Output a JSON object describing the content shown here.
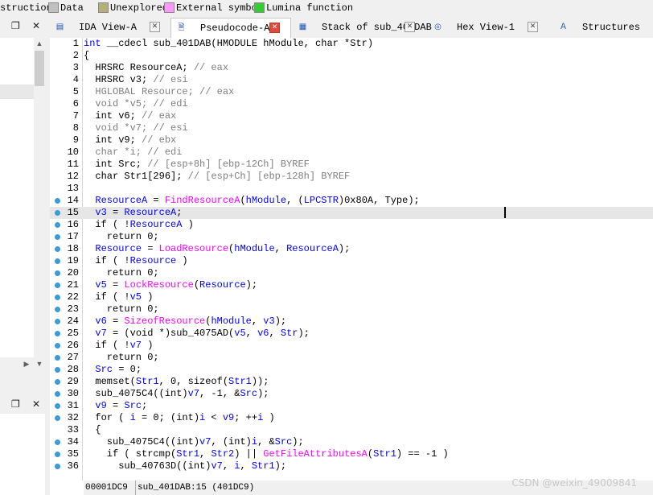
{
  "legend": {
    "items": [
      {
        "label": "struction",
        "color": null
      },
      {
        "label": "Data",
        "color": "#c0c0c0"
      },
      {
        "label": "Unexplored",
        "color": "#b5b07a"
      },
      {
        "label": "External symbol",
        "color": "#ff99ff"
      },
      {
        "label": "Lumina function",
        "color": "#33cc33"
      }
    ]
  },
  "left_pane": {
    "pin_icon": "pin-icon",
    "close_label": "✕"
  },
  "tabs": [
    {
      "label": "IDA View-A",
      "icon": "ida-view-icon",
      "active": false
    },
    {
      "label": "Pseudocode-A",
      "icon": "pseudocode-icon",
      "active": true
    },
    {
      "label": "Stack of sub_401DAB",
      "icon": "stack-icon",
      "active": false
    },
    {
      "label": "Hex View-1",
      "icon": "hex-icon",
      "active": false
    },
    {
      "label": "Structures",
      "icon": "structures-icon",
      "active": false
    }
  ],
  "code": {
    "current_line": 15,
    "lines": [
      {
        "n": "1",
        "bp": false,
        "seg": [
          [
            "t",
            "int"
          ],
          [
            "p",
            " __cdecl sub_401DAB(HMODULE hModule, char *Str)"
          ]
        ]
      },
      {
        "n": "2",
        "bp": false,
        "seg": [
          [
            "p",
            "{"
          ]
        ]
      },
      {
        "n": "3",
        "bp": false,
        "seg": [
          [
            "p",
            "  HRSRC ResourceA; "
          ],
          [
            "c",
            "// eax"
          ]
        ]
      },
      {
        "n": "4",
        "bp": false,
        "seg": [
          [
            "p",
            "  HRSRC v3; "
          ],
          [
            "c",
            "// esi"
          ]
        ]
      },
      {
        "n": "5",
        "bp": false,
        "seg": [
          [
            "c",
            "  HGLOBAL Resource; // eax"
          ]
        ]
      },
      {
        "n": "6",
        "bp": false,
        "seg": [
          [
            "c",
            "  void *v5; // edi"
          ]
        ]
      },
      {
        "n": "7",
        "bp": false,
        "seg": [
          [
            "p",
            "  int v6; "
          ],
          [
            "c",
            "// eax"
          ]
        ]
      },
      {
        "n": "8",
        "bp": false,
        "seg": [
          [
            "c",
            "  void *v7; // esi"
          ]
        ]
      },
      {
        "n": "9",
        "bp": false,
        "seg": [
          [
            "p",
            "  int v9; "
          ],
          [
            "c",
            "// ebx"
          ]
        ]
      },
      {
        "n": "10",
        "bp": false,
        "seg": [
          [
            "c",
            "  char *i; // edi"
          ]
        ]
      },
      {
        "n": "11",
        "bp": false,
        "seg": [
          [
            "p",
            "  int Src; "
          ],
          [
            "c",
            "// [esp+8h] [ebp-12Ch] BYREF"
          ]
        ]
      },
      {
        "n": "12",
        "bp": false,
        "seg": [
          [
            "p",
            "  char Str1[296]; "
          ],
          [
            "c",
            "// [esp+Ch] [ebp-128h] BYREF"
          ]
        ]
      },
      {
        "n": "13",
        "bp": false,
        "seg": [
          [
            "p",
            ""
          ]
        ]
      },
      {
        "n": "14",
        "bp": true,
        "seg": [
          [
            "v",
            "  ResourceA"
          ],
          [
            "p",
            " = "
          ],
          [
            "f",
            "FindResourceA"
          ],
          [
            "p",
            "("
          ],
          [
            "v",
            "hModule"
          ],
          [
            "p",
            ", ("
          ],
          [
            "v",
            "LPCSTR"
          ],
          [
            "p",
            ")0x80A, Type);"
          ]
        ]
      },
      {
        "n": "15",
        "bp": true,
        "seg": [
          [
            "v",
            "  v3"
          ],
          [
            "p",
            " = "
          ],
          [
            "v",
            "ResourceA"
          ],
          [
            "p",
            ";"
          ]
        ]
      },
      {
        "n": "16",
        "bp": true,
        "seg": [
          [
            "p",
            "  if ( !"
          ],
          [
            "v",
            "ResourceA"
          ],
          [
            "p",
            " )"
          ]
        ]
      },
      {
        "n": "17",
        "bp": true,
        "seg": [
          [
            "p",
            "    return 0;"
          ]
        ]
      },
      {
        "n": "18",
        "bp": true,
        "seg": [
          [
            "v",
            "  Resource"
          ],
          [
            "p",
            " = "
          ],
          [
            "f",
            "LoadResource"
          ],
          [
            "p",
            "("
          ],
          [
            "v",
            "hModule"
          ],
          [
            "p",
            ", "
          ],
          [
            "v",
            "ResourceA"
          ],
          [
            "p",
            ");"
          ]
        ]
      },
      {
        "n": "19",
        "bp": true,
        "seg": [
          [
            "p",
            "  if ( !"
          ],
          [
            "v",
            "Resource"
          ],
          [
            "p",
            " )"
          ]
        ]
      },
      {
        "n": "20",
        "bp": true,
        "seg": [
          [
            "p",
            "    return 0;"
          ]
        ]
      },
      {
        "n": "21",
        "bp": true,
        "seg": [
          [
            "v",
            "  v5"
          ],
          [
            "p",
            " = "
          ],
          [
            "f",
            "LockResource"
          ],
          [
            "p",
            "("
          ],
          [
            "v",
            "Resource"
          ],
          [
            "p",
            ");"
          ]
        ]
      },
      {
        "n": "22",
        "bp": true,
        "seg": [
          [
            "p",
            "  if ( !"
          ],
          [
            "v",
            "v5"
          ],
          [
            "p",
            " )"
          ]
        ]
      },
      {
        "n": "23",
        "bp": true,
        "seg": [
          [
            "p",
            "    return 0;"
          ]
        ]
      },
      {
        "n": "24",
        "bp": true,
        "seg": [
          [
            "v",
            "  v6"
          ],
          [
            "p",
            " = "
          ],
          [
            "f",
            "SizeofResource"
          ],
          [
            "p",
            "("
          ],
          [
            "v",
            "hModule"
          ],
          [
            "p",
            ", "
          ],
          [
            "v",
            "v3"
          ],
          [
            "p",
            ");"
          ]
        ]
      },
      {
        "n": "25",
        "bp": true,
        "seg": [
          [
            "v",
            "  v7"
          ],
          [
            "p",
            " = (void *)sub_4075AD("
          ],
          [
            "v",
            "v5"
          ],
          [
            "p",
            ", "
          ],
          [
            "v",
            "v6"
          ],
          [
            "p",
            ", "
          ],
          [
            "v",
            "Str"
          ],
          [
            "p",
            ");"
          ]
        ]
      },
      {
        "n": "26",
        "bp": true,
        "seg": [
          [
            "p",
            "  if ( !"
          ],
          [
            "v",
            "v7"
          ],
          [
            "p",
            " )"
          ]
        ]
      },
      {
        "n": "27",
        "bp": true,
        "seg": [
          [
            "p",
            "    return 0;"
          ]
        ]
      },
      {
        "n": "28",
        "bp": true,
        "seg": [
          [
            "v",
            "  Src"
          ],
          [
            "p",
            " = 0;"
          ]
        ]
      },
      {
        "n": "29",
        "bp": true,
        "seg": [
          [
            "p",
            "  memset("
          ],
          [
            "v",
            "Str1"
          ],
          [
            "p",
            ", 0, sizeof("
          ],
          [
            "v",
            "Str1"
          ],
          [
            "p",
            "));"
          ]
        ]
      },
      {
        "n": "30",
        "bp": true,
        "seg": [
          [
            "p",
            "  sub_4075C4((int)"
          ],
          [
            "v",
            "v7"
          ],
          [
            "p",
            ", -1, &"
          ],
          [
            "v",
            "Src"
          ],
          [
            "p",
            ");"
          ]
        ]
      },
      {
        "n": "31",
        "bp": true,
        "seg": [
          [
            "v",
            "  v9"
          ],
          [
            "p",
            " = "
          ],
          [
            "v",
            "Src"
          ],
          [
            "p",
            ";"
          ]
        ]
      },
      {
        "n": "32",
        "bp": true,
        "seg": [
          [
            "p",
            "  for ( "
          ],
          [
            "v",
            "i"
          ],
          [
            "p",
            " = 0; (int)"
          ],
          [
            "v",
            "i"
          ],
          [
            "p",
            " < "
          ],
          [
            "v",
            "v9"
          ],
          [
            "p",
            "; ++"
          ],
          [
            "v",
            "i"
          ],
          [
            "p",
            " )"
          ]
        ]
      },
      {
        "n": "33",
        "bp": false,
        "seg": [
          [
            "p",
            "  {"
          ]
        ]
      },
      {
        "n": "34",
        "bp": true,
        "seg": [
          [
            "p",
            "    sub_4075C4((int)"
          ],
          [
            "v",
            "v7"
          ],
          [
            "p",
            ", (int)"
          ],
          [
            "v",
            "i"
          ],
          [
            "p",
            ", &"
          ],
          [
            "v",
            "Src"
          ],
          [
            "p",
            ");"
          ]
        ]
      },
      {
        "n": "35",
        "bp": true,
        "seg": [
          [
            "p",
            "    if ( strcmp("
          ],
          [
            "v",
            "Str1"
          ],
          [
            "p",
            ", "
          ],
          [
            "v",
            "Str2"
          ],
          [
            "p",
            ") || "
          ],
          [
            "f",
            "GetFileAttributesA"
          ],
          [
            "p",
            "("
          ],
          [
            "v",
            "Str1"
          ],
          [
            "p",
            ") == -1 )"
          ]
        ]
      },
      {
        "n": "36",
        "bp": true,
        "seg": [
          [
            "p",
            "      sub_40763D((int)"
          ],
          [
            "v",
            "v7"
          ],
          [
            "p",
            ", "
          ],
          [
            "v",
            "i"
          ],
          [
            "p",
            ", "
          ],
          [
            "v",
            "Str1"
          ],
          [
            "p",
            ");"
          ]
        ]
      }
    ]
  },
  "status": {
    "address": "00001DC9",
    "location": "sub_401DAB:15 (401DC9)"
  },
  "watermark": "CSDN @weixin_49009841",
  "colors": {
    "keyword": "#0000ff",
    "variable": "#0000ff",
    "comment": "#808080",
    "function": "#ff00ff",
    "breakpoint": "#3b9bd9"
  }
}
